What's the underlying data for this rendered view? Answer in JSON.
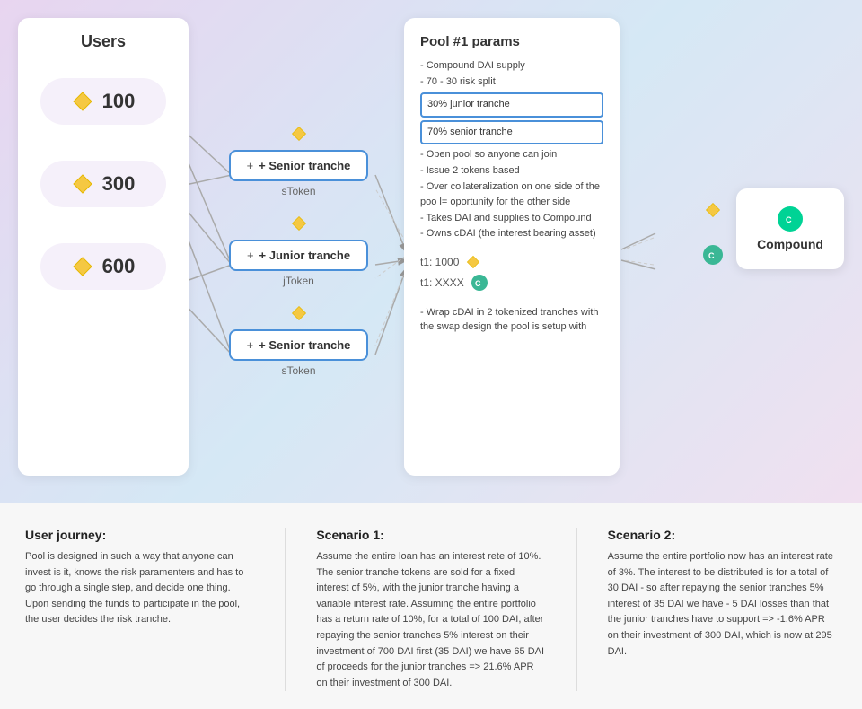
{
  "main": {
    "users_title": "Users",
    "users": [
      {
        "amount": "100"
      },
      {
        "amount": "300"
      },
      {
        "amount": "600"
      }
    ],
    "tranches": [
      {
        "label": "+ Senior tranche",
        "token": "sToken"
      },
      {
        "label": "+ Junior tranche",
        "token": "jToken"
      },
      {
        "label": "+ Senior tranche",
        "token": "sToken"
      }
    ],
    "pool_title": "Pool #1 params",
    "pool_params": [
      "- Compound DAI supply",
      "- 70 - 30 risk split"
    ],
    "pool_highlight1": "30% junior tranche",
    "pool_highlight2": "70% senior tranche",
    "pool_params2": [
      "- Open pool so anyone can join",
      "- Issue 2 tokens based",
      "- Over collateralization on one side of the poo l= oportunity for the other side",
      "- Takes DAI and supplies to Compound",
      "- Owns cDAI (the interest bearing asset)"
    ],
    "t1_1000": "t1: 1000",
    "t1_xxxx": "t1: XXXX",
    "wrap_text": "- Wrap cDAI in 2 tokenized tranches with the swap design the pool is setup with",
    "compound_label": "Compound"
  },
  "bottom": {
    "col1_title": "User journey:",
    "col1_text": "Pool is designed in such a way that anyone can invest is it, knows the risk paramenters and has to go through a single step, and decide one thing. Upon sending the funds to participate in the pool, the user decides the risk tranche.",
    "col2_title": "Scenario 1:",
    "col2_text": "Assume the entire loan has an interest rete of 10%. The senior tranche tokens are sold for a fixed interest of 5%, with the junior tranche having a variable interest rate. Assuming the entire portfolio has a return rate of 10%, for a total of 100 DAI, after repaying the senior tranches 5% interest on their investment of 700 DAI first (35 DAI) we have 65 DAI of proceeds for the junior tranches => 21.6% APR on their investment of 300 DAI.",
    "col3_title": "Scenario 2:",
    "col3_text": "Assume the entire portfolio now has an interest rate of 3%. The interest to be distributed is for a total of 30 DAI - so after repaying the senior tranches 5% interest of 35 DAI we have - 5 DAI losses than that the junior tranches have to support => -1.6% APR on their investment of 300 DAI, which is now at 295 DAI."
  }
}
